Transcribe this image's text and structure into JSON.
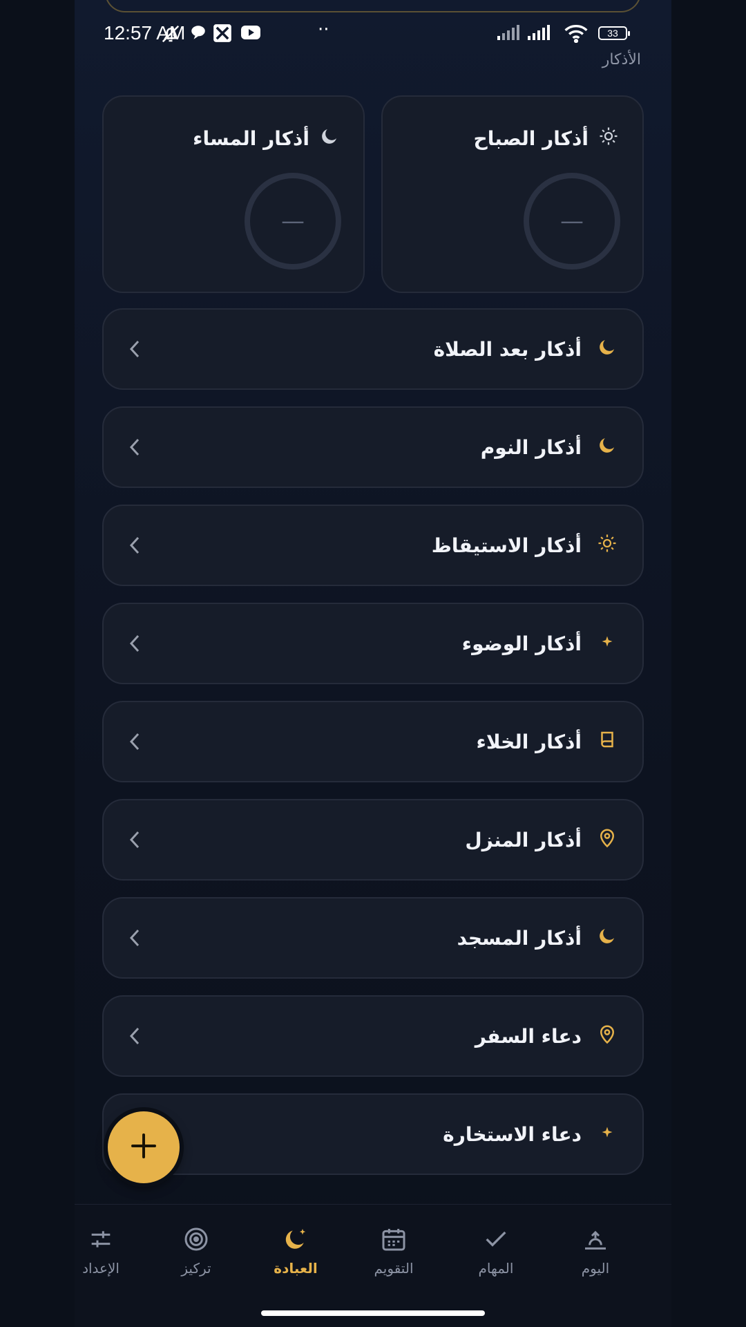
{
  "status": {
    "time": "12:57 AM",
    "battery": "33",
    "more": "··"
  },
  "page": {
    "label": "الأذكار"
  },
  "morning": {
    "title": "أذكار الصباح",
    "icon": "sun-icon",
    "progress": "—"
  },
  "evening": {
    "title": "أذكار المساء",
    "icon": "moon-icon",
    "progress": "—"
  },
  "list": [
    {
      "title": "أذكار بعد الصلاة",
      "icon": "moon-icon"
    },
    {
      "title": "أذكار النوم",
      "icon": "moon-icon"
    },
    {
      "title": "أذكار الاستيقاظ",
      "icon": "sun-icon"
    },
    {
      "title": "أذكار الوضوء",
      "icon": "sparkle-icon"
    },
    {
      "title": "أذكار الخلاء",
      "icon": "book-icon"
    },
    {
      "title": "أذكار المنزل",
      "icon": "location-pin-icon"
    },
    {
      "title": "أذكار المسجد",
      "icon": "moon-icon"
    },
    {
      "title": "دعاء السفر",
      "icon": "location-pin-icon"
    },
    {
      "title": "دعاء الاستخارة",
      "icon": "sparkle-icon"
    }
  ],
  "fab": {
    "icon": "plus-icon"
  },
  "nav": [
    {
      "label": "اليوم",
      "icon": "sunset-icon"
    },
    {
      "label": "المهام",
      "icon": "check-icon"
    },
    {
      "label": "التقويم",
      "icon": "calendar-icon"
    },
    {
      "label": "العبادة",
      "icon": "moon-star-icon",
      "active": true
    },
    {
      "label": "تركيز",
      "icon": "target-icon"
    },
    {
      "label": "الإعداد",
      "icon": "sliders-icon"
    }
  ],
  "colors": {
    "accent": "#e6b24a",
    "background": "#0f1626",
    "card": "#161c29",
    "muted_text": "#8c93a4"
  }
}
